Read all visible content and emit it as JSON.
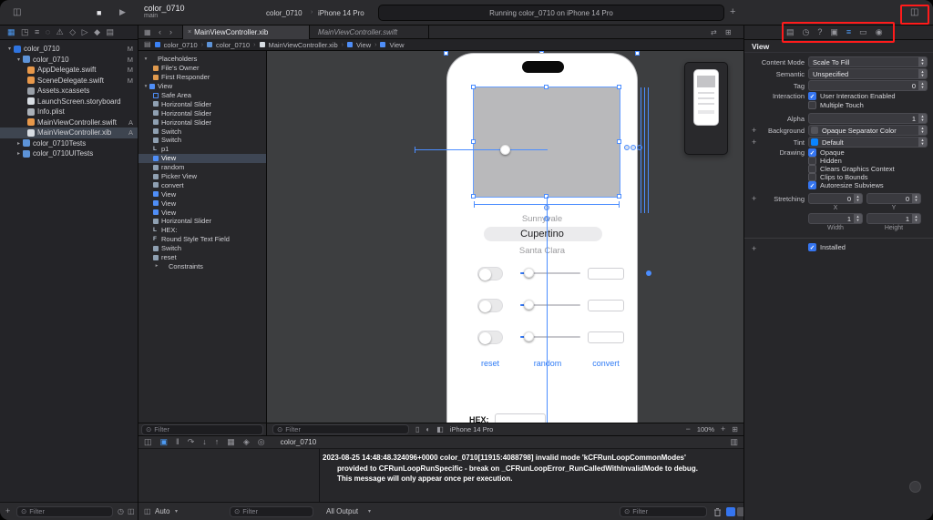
{
  "icons": {
    "sidebar_toggle": "◫",
    "stop": "■",
    "play": "▶",
    "library_plus": "+",
    "inspector_toggle": "◫",
    "back": "‹",
    "forward": "›",
    "tab_overview": "▦",
    "close": "×",
    "editor_split": "⊞",
    "editor_arrange": "⇄",
    "outline_toggle": "▤",
    "breadcrumb_sep": "›",
    "filter": "⊙",
    "add": "+",
    "recents": "◷",
    "scm": "◫",
    "nav_tabs": [
      "▦",
      "◳",
      "≡",
      "◌",
      "⚠",
      "◇",
      "▷",
      "◆",
      "▤"
    ],
    "inspector_tabs": [
      "▤",
      "◷",
      "?",
      "▣",
      "≡",
      "▭",
      "◉"
    ],
    "debug_bar": [
      "◫",
      "▣",
      "‖",
      "↷",
      "↓",
      "↑",
      "▦",
      "◈",
      "◎"
    ],
    "console_toggle": "▥",
    "popup_chevron": "▾",
    "zoom_out": "−",
    "zoom_in": "+",
    "canvas_fit": "⊞",
    "device_icons": [
      "▯",
      "◐",
      "◧"
    ]
  },
  "toolbar": {
    "project": "color_0710",
    "branch": "main",
    "scheme": "color_0710",
    "destination": "iPhone 14 Pro",
    "status": "Running color_0710 on iPhone 14 Pro"
  },
  "navigator": {
    "files": [
      {
        "name": "color_0710",
        "badge": "M"
      },
      {
        "name": "color_0710",
        "badge": "M"
      },
      {
        "name": "AppDelegate.swift",
        "badge": "M"
      },
      {
        "name": "SceneDelegate.swift",
        "badge": "M"
      },
      {
        "name": "Assets.xcassets",
        "badge": ""
      },
      {
        "name": "LaunchScreen.storyboard",
        "badge": ""
      },
      {
        "name": "Info.plist",
        "badge": ""
      },
      {
        "name": "MainViewController.swift",
        "badge": "A"
      },
      {
        "name": "MainViewController.xib",
        "badge": "A",
        "selected": true
      },
      {
        "name": "color_0710Tests",
        "badge": ""
      },
      {
        "name": "color_0710UITests",
        "badge": ""
      }
    ]
  },
  "editor": {
    "tabs": [
      {
        "label": "MainViewController.xib",
        "active": true
      },
      {
        "label": "MainViewController.swift",
        "active": false
      }
    ],
    "breadcrumbs": [
      "color_0710",
      "color_0710",
      "MainViewController.xib",
      "View",
      "View"
    ],
    "outline": {
      "items": [
        {
          "label": "Placeholders"
        },
        {
          "label": "File's Owner"
        },
        {
          "label": "First Responder"
        },
        {
          "label": "View"
        },
        {
          "label": "Safe Area"
        },
        {
          "label": "Horizontal Slider"
        },
        {
          "label": "Horizontal Slider"
        },
        {
          "label": "Horizontal Slider"
        },
        {
          "label": "Switch"
        },
        {
          "label": "Switch"
        },
        {
          "label": "p1"
        },
        {
          "label": "View",
          "selected": true
        },
        {
          "label": "random"
        },
        {
          "label": "Picker View"
        },
        {
          "label": "convert"
        },
        {
          "label": "View"
        },
        {
          "label": "View"
        },
        {
          "label": "View"
        },
        {
          "label": "Horizontal Slider"
        },
        {
          "label": "HEX:"
        },
        {
          "label": "Round Style Text Field"
        },
        {
          "label": "Switch"
        },
        {
          "label": "reset"
        },
        {
          "label": "Constraints"
        }
      ]
    },
    "canvas": {
      "picker": [
        "Sunnyvale",
        "Cupertino",
        "Santa Clara"
      ],
      "buttons": [
        "reset",
        "random",
        "convert"
      ],
      "hex_label": "HEX:",
      "device": "iPhone 14 Pro",
      "zoom": "100%"
    }
  },
  "debug": {
    "process": "color_0710",
    "variables_scope": "Auto",
    "output_scope": "All Output",
    "console": [
      "2023-08-25 14:48:48.324096+0000 color_0710[11915:4088798] invalid mode 'kCFRunLoopCommonModes'",
      "provided to CFRunLoopRunSpecific - break on _CFRunLoopError_RunCalledWithInvalidMode to debug.",
      "This message will only appear once per execution."
    ]
  },
  "inspector": {
    "title": "View",
    "rows": {
      "content_mode": {
        "label": "Content Mode",
        "value": "Scale To Fill"
      },
      "semantic": {
        "label": "Semantic",
        "value": "Unspecified"
      },
      "tag": {
        "label": "Tag",
        "value": "0"
      },
      "interaction_label": "Interaction",
      "user_interaction": {
        "label": "User Interaction Enabled",
        "checked": true
      },
      "multiple_touch": {
        "label": "Multiple Touch",
        "checked": false
      },
      "alpha": {
        "label": "Alpha",
        "value": "1"
      },
      "background": {
        "label": "Background",
        "value": "Opaque Separator Color"
      },
      "tint": {
        "label": "Tint",
        "value": "Default"
      },
      "drawing_label": "Drawing",
      "opaque": {
        "label": "Opaque",
        "checked": true
      },
      "hidden": {
        "label": "Hidden",
        "checked": false
      },
      "clears": {
        "label": "Clears Graphics Context",
        "checked": false
      },
      "clips": {
        "label": "Clips to Bounds",
        "checked": false
      },
      "autoresize": {
        "label": "Autoresize Subviews",
        "checked": true
      },
      "stretching_label": "Stretching",
      "stretch_x": "0",
      "stretch_y": "0",
      "stretch_w": "1",
      "stretch_h": "1",
      "x_label": "X",
      "y_label": "Y",
      "width_label": "Width",
      "height_label": "Height",
      "installed": {
        "label": "Installed",
        "checked": true
      }
    }
  },
  "common": {
    "filter_placeholder": "Filter"
  },
  "annotation_colors": {
    "highlight_red": "#ff1b1b"
  }
}
